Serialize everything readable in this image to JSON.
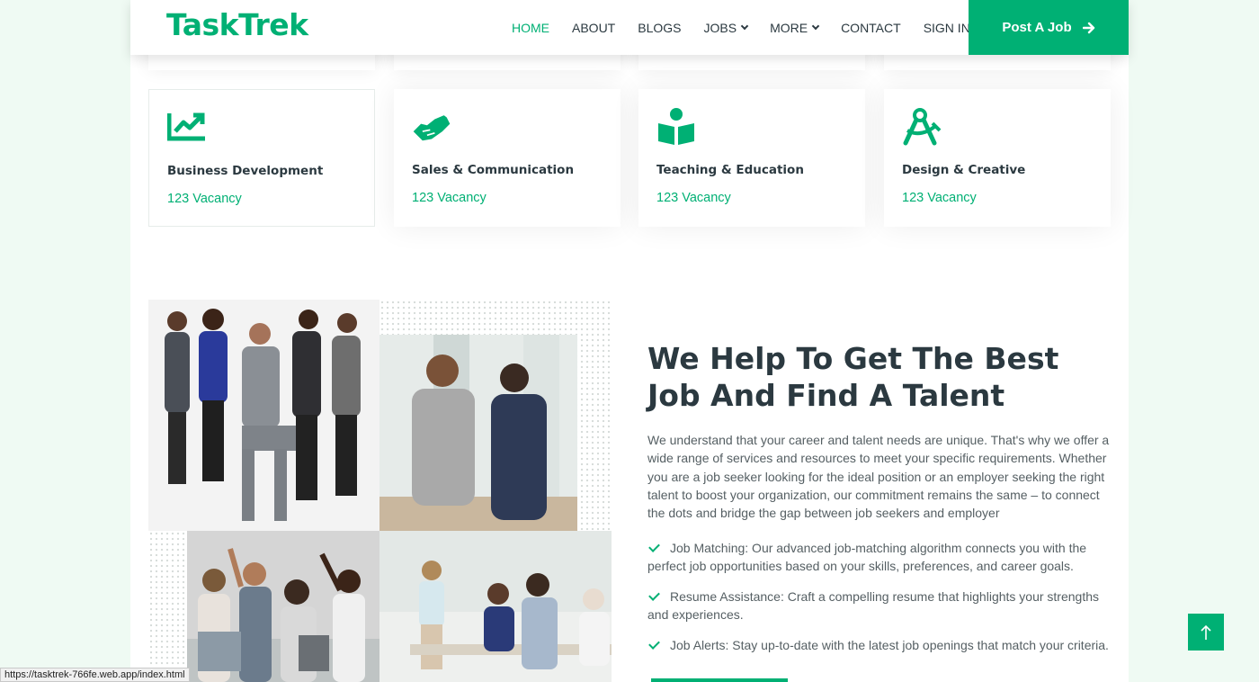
{
  "brand": "TaskTrek",
  "nav": {
    "items": [
      {
        "label": "HOME",
        "active": true,
        "dropdown": false
      },
      {
        "label": "ABOUT",
        "active": false,
        "dropdown": false
      },
      {
        "label": "BLOGS",
        "active": false,
        "dropdown": false
      },
      {
        "label": "JOBS",
        "active": false,
        "dropdown": true
      },
      {
        "label": "MORE",
        "active": false,
        "dropdown": true
      },
      {
        "label": "CONTACT",
        "active": false,
        "dropdown": false
      },
      {
        "label": "SIGN IN",
        "active": false,
        "dropdown": false
      }
    ],
    "cta": "Post A Job"
  },
  "categories": [
    {
      "title": "Business Development",
      "count": "123 Vacancy",
      "icon": "chart-line-icon"
    },
    {
      "title": "Sales & Communication",
      "count": "123 Vacancy",
      "icon": "handshake-icon"
    },
    {
      "title": "Teaching & Education",
      "count": "123 Vacancy",
      "icon": "book-reader-icon"
    },
    {
      "title": "Design & Creative",
      "count": "123 Vacancy",
      "icon": "drafting-compass-icon"
    }
  ],
  "about": {
    "title": "We Help To Get The Best Job And Find A Talent",
    "description": "We understand that your career and talent needs are unique. That's why we offer a wide range of services and resources to meet your specific requirements. Whether you are a job seeker looking for the ideal position or an employer seeking the right talent to boost your organization, our commitment remains the same – to connect the dots and bridge the gap between job seekers and employer",
    "features": [
      "Job Matching: Our advanced job-matching algorithm connects you with the perfect job opportunities based on your skills, preferences, and career goals.",
      "Resume Assistance: Craft a compelling resume that highlights your strengths and experiences.",
      "Job Alerts: Stay up-to-date with the latest job openings that match your criteria."
    ]
  },
  "status_url": "https://tasktrek-766fe.web.app/index.html",
  "colors": {
    "accent": "#00b074",
    "heading": "#2b3940",
    "text": "#555f63",
    "background": "#effaf3"
  }
}
